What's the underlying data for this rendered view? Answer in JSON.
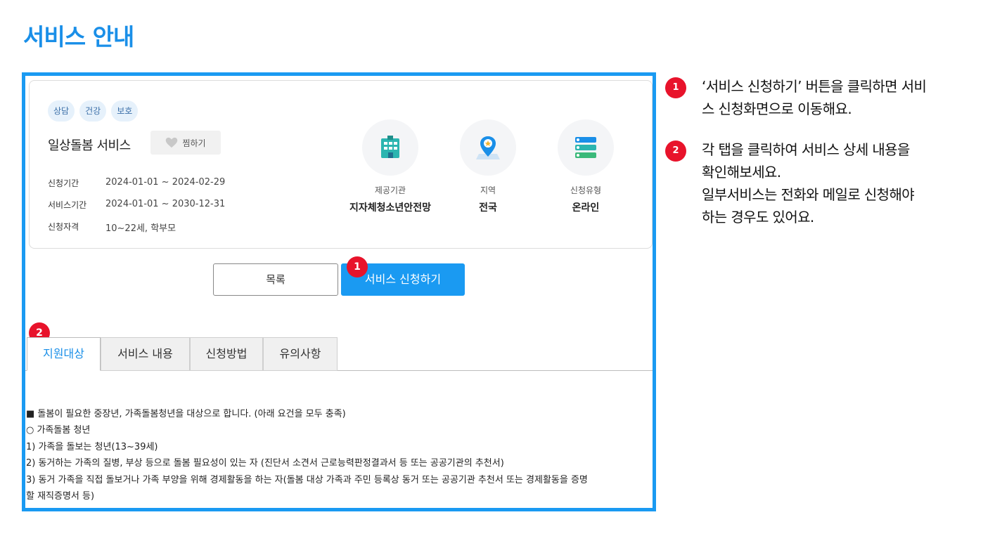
{
  "page": {
    "title": "서비스 안내"
  },
  "card": {
    "tags": [
      "상담",
      "건강",
      "보호"
    ],
    "service_name": "일상돌봄 서비스",
    "favorite_label": "찜하기",
    "info": [
      {
        "label": "신청기간",
        "value": "2024-01-01 ~ 2024-02-29"
      },
      {
        "label": "서비스기간",
        "value": "2024-01-01 ~ 2030-12-31"
      },
      {
        "label": "신청자격",
        "value": "10~22세, 학부모"
      }
    ],
    "stats": [
      {
        "label": "제공기관",
        "value": "지자체청소년안전망",
        "icon": "building-icon"
      },
      {
        "label": "지역",
        "value": "전국",
        "icon": "map-pin-icon"
      },
      {
        "label": "신청유형",
        "value": "온라인",
        "icon": "form-list-icon"
      }
    ]
  },
  "buttons": {
    "list_label": "목록",
    "apply_label": "서비스 신청하기"
  },
  "badges": {
    "one": "1",
    "two": "2"
  },
  "tabs": [
    "지원대상",
    "서비스 내용",
    "신청방법",
    "유의사항"
  ],
  "description": [
    "■ 돌봄이 필요한 중장년, 가족돌봄청년을 대상으로 합니다. (아래 요건을 모두 충족)",
    "○ 가족돌봄 청년",
    "1) 가족을 돌보는 청년(13~39세)",
    "2) 동거하는 가족의 질병, 부상 등으로 돌봄 필요성이 있는 자 (진단서 소견서 근로능력판정결과서 등 또는 공공기관의 추천서)",
    "3) 동거 가족을 직접 돌보거나 가족 부양을 위해 경제활동을 하는 자(돌봄 대상 가족과 주민 등록상 동거 또는 공공기관 추천서 또는 경제활동을 증명",
    "할 재직증명서 등)"
  ],
  "notes": [
    {
      "num": "1",
      "lines": [
        "‘서비스 신청하기’ 버튼을 클릭하면 서비",
        "스 신청화면으로 이동해요."
      ]
    },
    {
      "num": "2",
      "lines": [
        "각 탭을 클릭하여 서비스 상세 내용을",
        "확인해보세요.",
        "일부서비스는 전화와 메일로 신청해야",
        "하는 경우도 있어요."
      ]
    }
  ],
  "colors": {
    "accent": "#1a9af2",
    "badge": "#e8132b",
    "title": "#1a8fe8"
  }
}
